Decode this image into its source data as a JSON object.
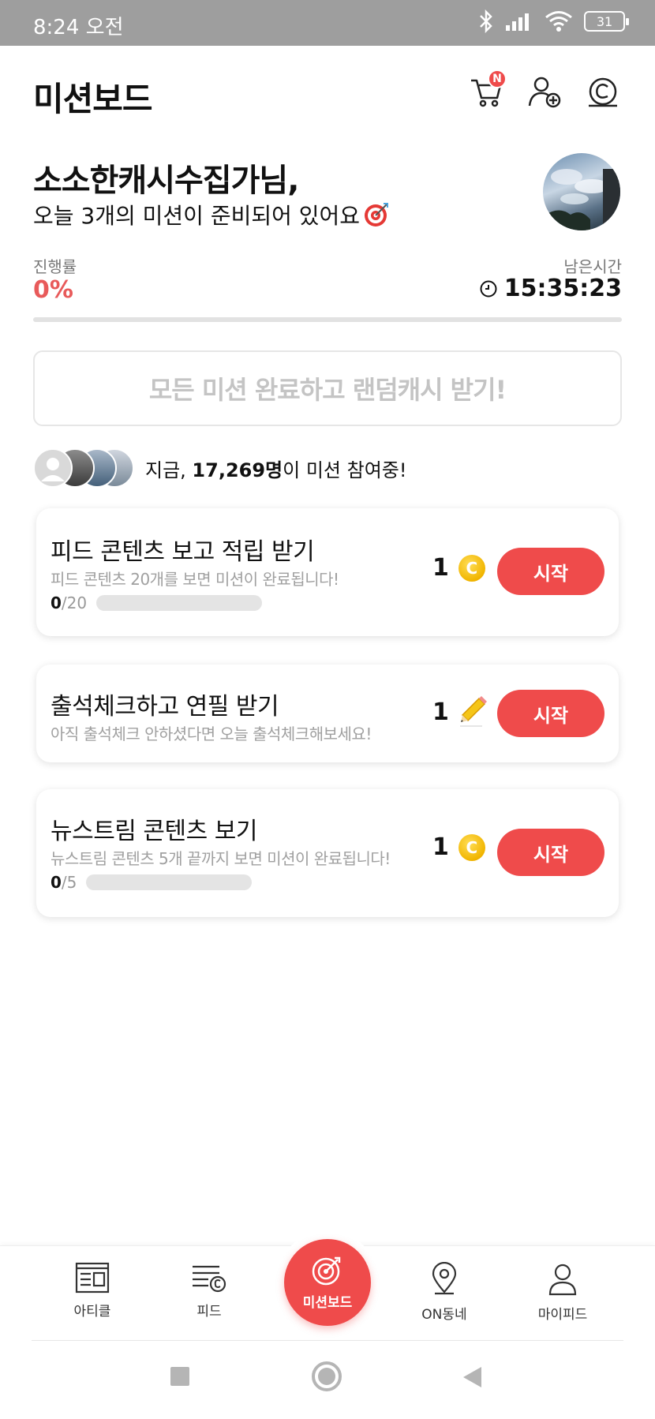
{
  "status_bar": {
    "time": "8:24 오전",
    "battery": "31"
  },
  "header": {
    "title": "미션보드",
    "cart_badge": "N"
  },
  "greeting": {
    "name": "소소한캐시수집가님,",
    "subtitle": "오늘 3개의 미션이 준비되어 있어요"
  },
  "progress": {
    "label": "진행률",
    "value": "0%",
    "fraction": 0
  },
  "timer": {
    "label": "남은시간",
    "value": "15:35:23"
  },
  "bonus": {
    "label": "모든 미션 완료하고 랜덤캐시 받기!"
  },
  "participants": {
    "prefix": "지금, ",
    "count": "17,269명",
    "suffix": "이 미션 참여중!"
  },
  "missions": [
    {
      "title": "피드 콘텐츠 보고 적립 받기",
      "desc": "피드 콘텐츠 20개를 보면 미션이 완료됩니다!",
      "done": "0",
      "total": "/20",
      "reward": "1",
      "reward_icon": "coin-icon",
      "button": "시작"
    },
    {
      "title": "출석체크하고 연필 받기",
      "desc": "아직 출석체크 안하셨다면 오늘 출석체크해보세요!",
      "reward": "1",
      "reward_icon": "pencil-icon",
      "button": "시작"
    },
    {
      "title": "뉴스트림 콘텐츠 보기",
      "desc": "뉴스트림 콘텐츠 5개 끝까지 보면 미션이 완료됩니다!",
      "done": "0",
      "total": "/5",
      "reward": "1",
      "reward_icon": "coin-icon",
      "button": "시작"
    }
  ],
  "nav": {
    "article": "아티클",
    "feed": "피드",
    "missionboard": "미션보드",
    "on_neighborhood": "ON동네",
    "my_feed": "마이피드"
  },
  "colors": {
    "accent": "#ef4b4b",
    "progress_text": "#e85a5a",
    "coin": "#f1b500"
  }
}
